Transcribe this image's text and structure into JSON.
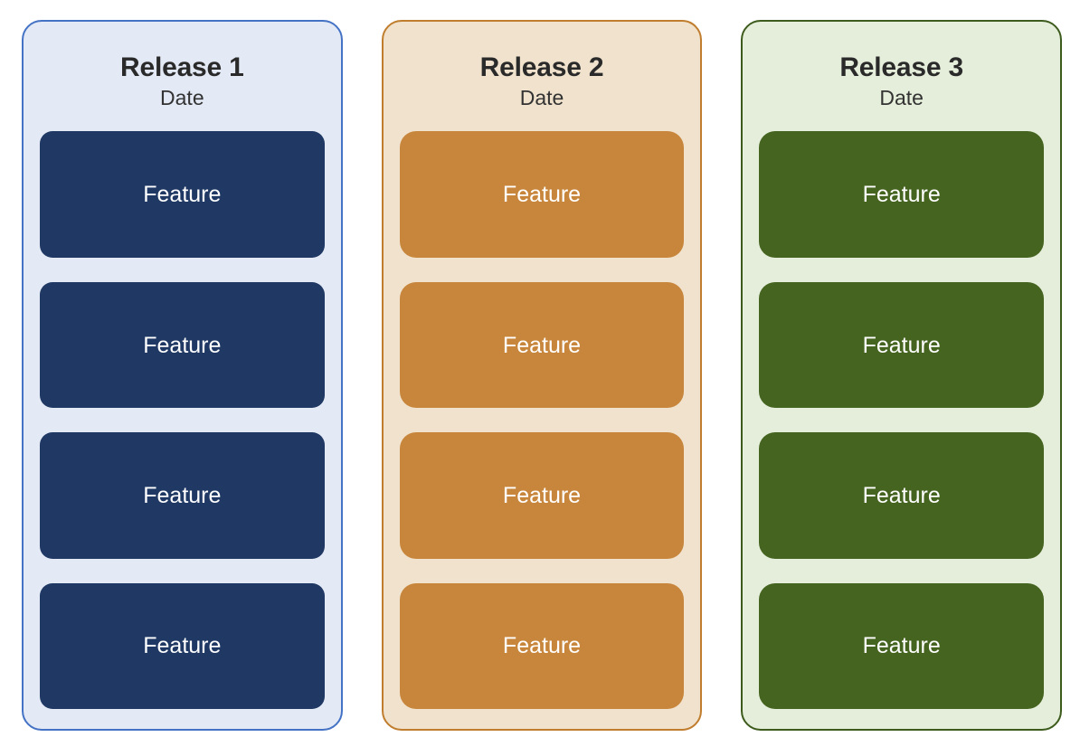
{
  "diagram": {
    "type": "release-roadmap",
    "page_background": "#ffffff",
    "columns": [
      {
        "title": "Release 1",
        "subtitle": "Date",
        "accent": "#1F3864",
        "border_color": "#4472C4",
        "background": "#E3E9F5",
        "card_text_color": "#FFFFFF",
        "features": [
          {
            "label": "Feature"
          },
          {
            "label": "Feature"
          },
          {
            "label": "Feature"
          },
          {
            "label": "Feature"
          }
        ]
      },
      {
        "title": "Release 2",
        "subtitle": "Date",
        "accent": "#C8863C",
        "border_color": "#C07D2E",
        "background": "#F0E2CC",
        "card_text_color": "#FFFFFF",
        "features": [
          {
            "label": "Feature"
          },
          {
            "label": "Feature"
          },
          {
            "label": "Feature"
          },
          {
            "label": "Feature"
          }
        ]
      },
      {
        "title": "Release 3",
        "subtitle": "Date",
        "accent": "#456420",
        "border_color": "#3D5B1C",
        "background": "#E5EEDA",
        "card_text_color": "#FFFFFF",
        "features": [
          {
            "label": "Feature"
          },
          {
            "label": "Feature"
          },
          {
            "label": "Feature"
          },
          {
            "label": "Feature"
          }
        ]
      }
    ]
  }
}
